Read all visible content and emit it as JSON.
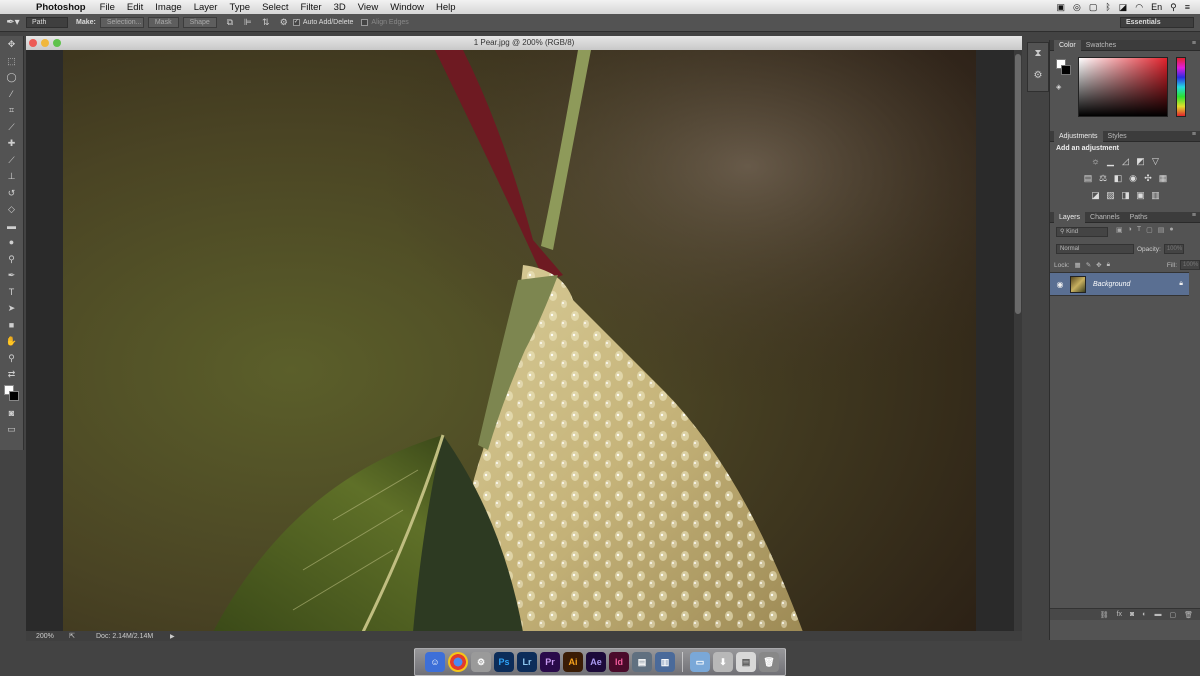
{
  "menubar": {
    "app_name": "Photoshop",
    "items": [
      "File",
      "Edit",
      "Image",
      "Layer",
      "Type",
      "Select",
      "Filter",
      "3D",
      "View",
      "Window",
      "Help"
    ],
    "language": "En"
  },
  "options_bar": {
    "mode": "Path",
    "make_label": "Make:",
    "selection_btn": "Selection...",
    "mask_btn": "Mask",
    "shape_btn": "Shape",
    "auto_add_delete": "Auto Add/Delete",
    "auto_add_delete_checked": true,
    "align_edges": "Align Edges",
    "align_edges_checked": false,
    "workspace": "Essentials"
  },
  "document": {
    "title": "1 Pear.jpg @ 200% (RGB/8)",
    "zoom": "200%",
    "doc_size": "Doc: 2.14M/2.14M"
  },
  "color_panel": {
    "tabs": [
      "Color",
      "Swatches"
    ],
    "foreground": "#ffffff",
    "background": "#000000",
    "hue_color": "#e1222c"
  },
  "adjustments_panel": {
    "tabs": [
      "Adjustments",
      "Styles"
    ],
    "hint": "Add an adjustment"
  },
  "layers_panel": {
    "tabs": [
      "Layers",
      "Channels",
      "Paths"
    ],
    "filter_kind": "Kind",
    "blend_mode": "Normal",
    "opacity_label": "Opacity:",
    "opacity_value": "100%",
    "lock_label": "Lock:",
    "fill_label": "Fill:",
    "fill_value": "100%",
    "layers": [
      {
        "name": "Background",
        "visible": true,
        "locked": true,
        "selected": true
      }
    ]
  },
  "colors": {
    "selection_blue": "#5a6f92",
    "panel_gray": "#535353"
  }
}
